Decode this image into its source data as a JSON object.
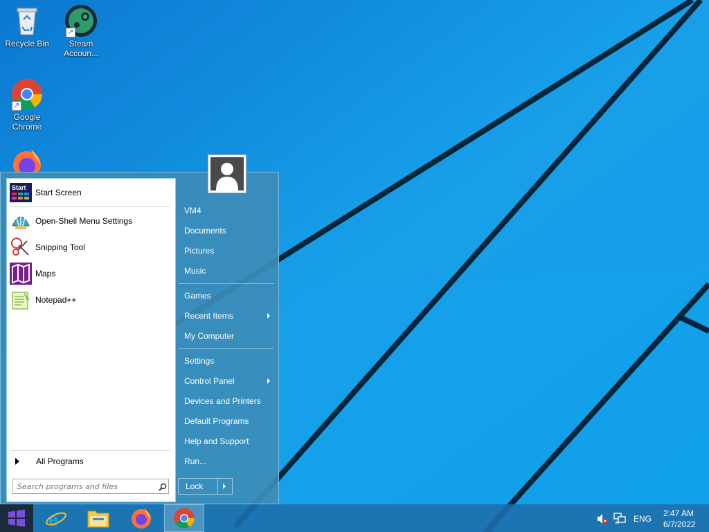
{
  "desktop": {
    "icons": [
      {
        "label": "Recycle Bin",
        "icon": "recycle-bin-icon"
      },
      {
        "label": "Steam Accoun...",
        "icon": "steam-icon"
      },
      {
        "label": "Google Chrome",
        "icon": "chrome-icon"
      },
      {
        "label": "",
        "icon": "firefox-icon"
      }
    ]
  },
  "start_menu": {
    "programs": [
      {
        "label": "Start Screen",
        "icon": "start-screen-icon"
      },
      {
        "label": "Open-Shell Menu Settings",
        "icon": "open-shell-icon"
      },
      {
        "label": "Snipping Tool",
        "icon": "snipping-tool-icon"
      },
      {
        "label": "Maps",
        "icon": "maps-icon"
      },
      {
        "label": "Notepad++",
        "icon": "notepadpp-icon"
      }
    ],
    "start_screen_icon_text": "Start",
    "all_programs": "All Programs",
    "search_placeholder": "Search programs and files",
    "right_items": [
      {
        "label": "VM4"
      },
      {
        "label": "Documents"
      },
      {
        "label": "Pictures"
      },
      {
        "label": "Music"
      },
      {
        "label": "Games"
      },
      {
        "label": "Recent Items",
        "submenu": true
      },
      {
        "label": "My Computer"
      },
      {
        "label": "Settings"
      },
      {
        "label": "Control Panel",
        "submenu": true
      },
      {
        "label": "Devices and Printers"
      },
      {
        "label": "Default Programs"
      },
      {
        "label": "Help and Support"
      },
      {
        "label": "Run..."
      }
    ],
    "lock_label": "Lock"
  },
  "taskbar": {
    "apps": [
      "internet-explorer-icon",
      "file-explorer-icon",
      "firefox-icon",
      "chrome-icon"
    ],
    "active_app": "chrome-icon",
    "language": "ENG",
    "time": "2:47 AM",
    "date": "6/7/2022"
  },
  "colors": {
    "desktop_blue": "#12a2ea",
    "menu_blue": "#3c8cb9",
    "taskbar": "#1e6eaa"
  }
}
